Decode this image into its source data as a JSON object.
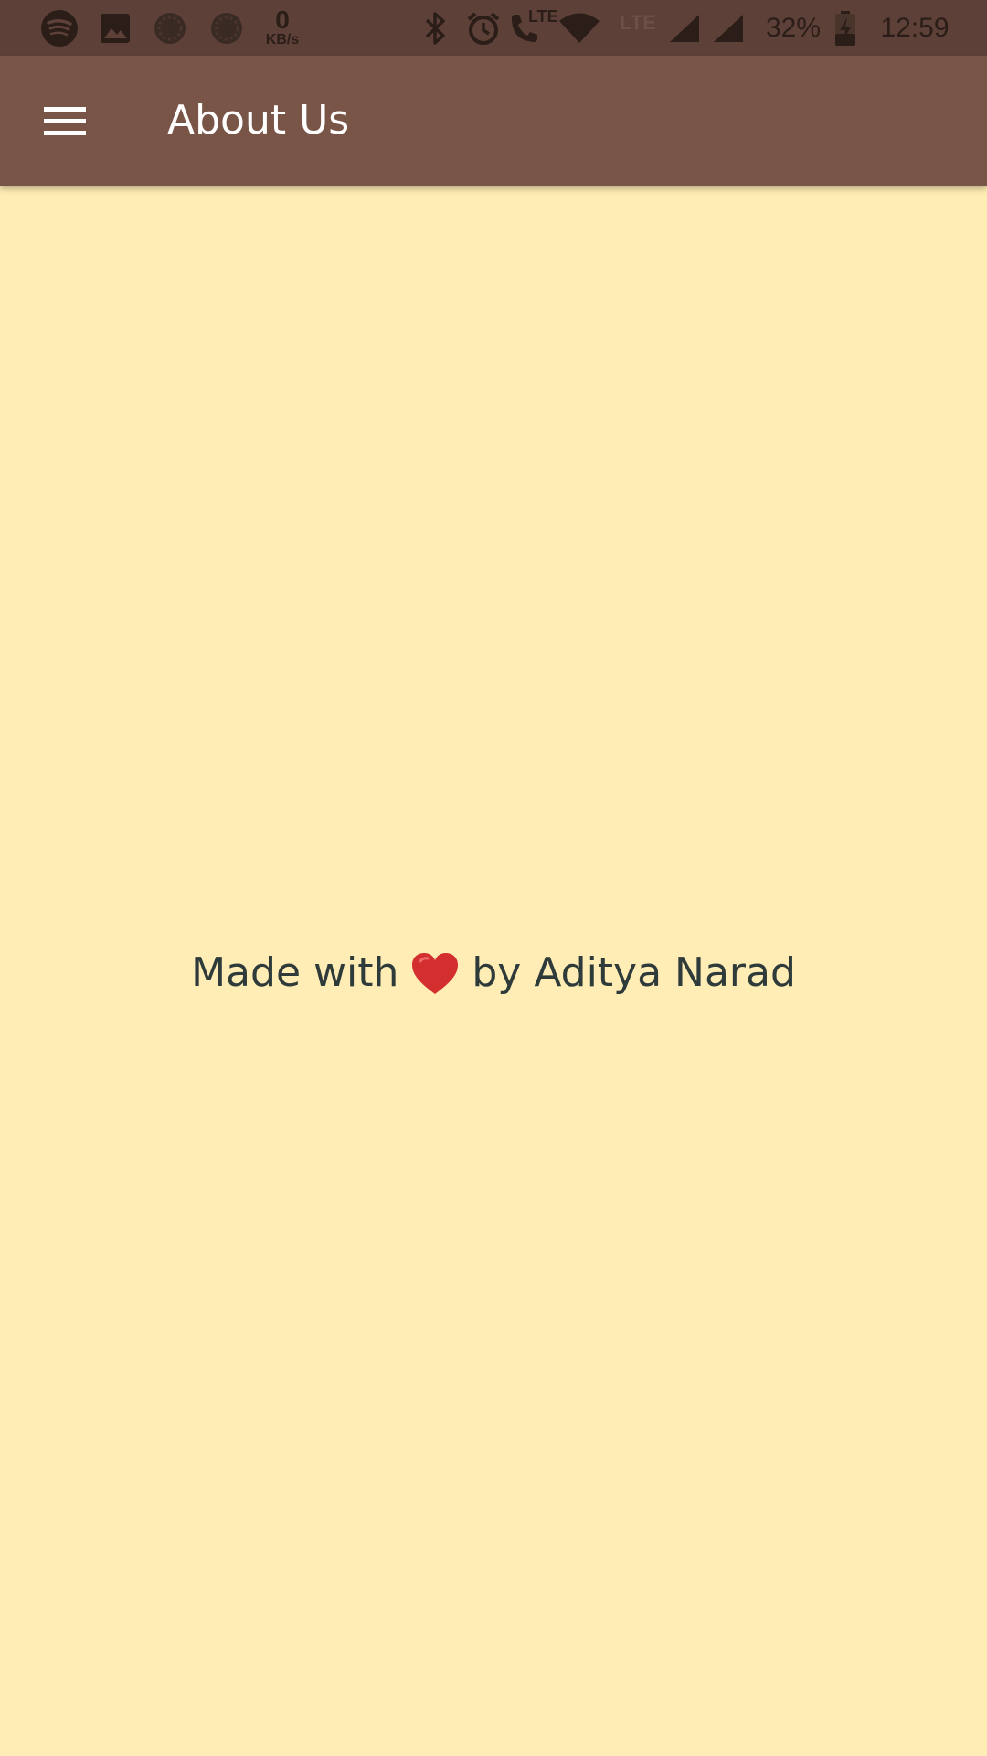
{
  "status_bar": {
    "net_speed_value": "0",
    "net_speed_unit": "KB/s",
    "lte_call_label": "LTE",
    "lte_label": "LTE",
    "battery": "32%",
    "time": "12:59",
    "icons": [
      "spotify-icon",
      "image-icon",
      "sync-icon",
      "sync-icon",
      "bluetooth-icon",
      "alarm-icon",
      "volte-call-icon",
      "wifi-icon",
      "signal-icon",
      "signal-icon",
      "battery-charging-icon"
    ]
  },
  "app_bar": {
    "title": "About Us",
    "menu_icon": "hamburger-menu-icon",
    "color": "#795548"
  },
  "content": {
    "credit_prefix": "Made with",
    "credit_icon": "heart-icon",
    "credit_suffix": "by Aditya Narad",
    "background": "#FFEDB5",
    "heart_color": "#D32F2F"
  }
}
